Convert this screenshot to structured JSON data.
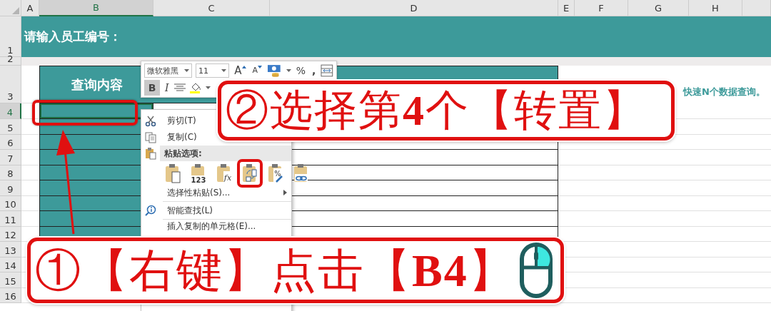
{
  "columns": [
    {
      "label": "A",
      "selected": false
    },
    {
      "label": "B",
      "selected": true
    },
    {
      "label": "C",
      "selected": false
    },
    {
      "label": "D",
      "selected": false
    },
    {
      "label": "E",
      "selected": false
    },
    {
      "label": "F",
      "selected": false
    },
    {
      "label": "G",
      "selected": false
    },
    {
      "label": "H",
      "selected": false
    }
  ],
  "rows": [
    {
      "label": "1",
      "selected": false
    },
    {
      "label": "2",
      "selected": false
    },
    {
      "label": "3",
      "selected": false
    },
    {
      "label": "4",
      "selected": true
    },
    {
      "label": "5",
      "selected": false
    },
    {
      "label": "6",
      "selected": false
    },
    {
      "label": "7",
      "selected": false
    },
    {
      "label": "8",
      "selected": false
    },
    {
      "label": "9",
      "selected": false
    },
    {
      "label": "10",
      "selected": false
    },
    {
      "label": "11",
      "selected": false
    },
    {
      "label": "12",
      "selected": false
    },
    {
      "label": "13",
      "selected": false
    },
    {
      "label": "14",
      "selected": false
    },
    {
      "label": "15",
      "selected": false
    },
    {
      "label": "16",
      "selected": false
    }
  ],
  "title_cell": "请输入员工编号：",
  "header_cell": "查询内容",
  "note_cell": "快速N个数据查询。",
  "mini_toolbar": {
    "font": "微软雅黑",
    "size": "11",
    "grow": "A",
    "shrink": "A",
    "percent": "%",
    "comma": ",",
    "bold": "B",
    "bold_selected": true,
    "italic": "I"
  },
  "context_menu": [
    {
      "kind": "cut",
      "label": "剪切(T)"
    },
    {
      "kind": "copy",
      "label": "复制(C)"
    },
    {
      "kind": "section",
      "label": "粘贴选项:"
    },
    {
      "kind": "paste_options",
      "options": [
        {
          "kind": "paste",
          "selected": false
        },
        {
          "kind": "values",
          "label": "123",
          "selected": false
        },
        {
          "kind": "formulas",
          "label": "fx",
          "selected": false
        },
        {
          "kind": "transpose",
          "selected": true
        },
        {
          "kind": "formatting",
          "label": "%",
          "selected": false
        },
        {
          "kind": "link",
          "selected": false
        }
      ]
    },
    {
      "kind": "submenu",
      "label": "选择性粘贴(S)..."
    },
    {
      "kind": "separator"
    },
    {
      "kind": "lookup",
      "label": "智能查找(L)"
    },
    {
      "kind": "separator"
    },
    {
      "kind": "command",
      "label": "插入复制的单元格(E)..."
    }
  ],
  "callouts": [
    {
      "kind": "step2",
      "text": "②选择第**4**个【转置】"
    },
    {
      "kind": "step1",
      "text": "①【右键】点击【**B4**】"
    }
  ]
}
